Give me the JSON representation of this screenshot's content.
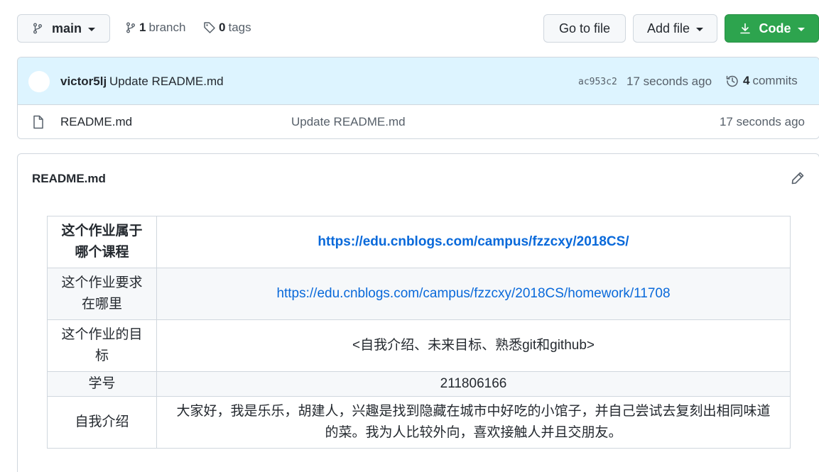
{
  "toolbar": {
    "branch_name": "main",
    "branch_count": "1",
    "branch_label": "branch",
    "tag_count": "0",
    "tag_label": "tags",
    "goto_label": "Go to file",
    "addfile_label": "Add file",
    "code_label": "Code"
  },
  "latest_commit": {
    "author": "victor5lj",
    "message": "Update README.md",
    "sha": "ac953c2",
    "time": "17 seconds ago",
    "commit_count": "4",
    "commit_label": "commits"
  },
  "files": [
    {
      "name": "README.md",
      "commit_message": "Update README.md",
      "time": "17 seconds ago"
    }
  ],
  "readme": {
    "title": "README.md",
    "rows": [
      {
        "key": "这个作业属于哪个课程",
        "value": "https://edu.cnblogs.com/campus/fzzcxy/2018CS/"
      },
      {
        "key": "这个作业要求在哪里",
        "value": "https://edu.cnblogs.com/campus/fzzcxy/2018CS/homework/11708"
      },
      {
        "key": "这个作业的目标",
        "value": "<自我介绍、未来目标、熟悉git和github>"
      },
      {
        "key": "学号",
        "value": "211806166"
      },
      {
        "key": "自我介绍",
        "value": "大家好，我是乐乐，胡建人，兴趣是找到隐藏在城市中好吃的小馆子，并自己尝试去复刻出相同味道的菜。我为人比较外向，喜欢接触人并且交朋友。"
      }
    ]
  },
  "colors": {
    "accent": "#0969da",
    "code_button": "#2da44e",
    "commit_bar": "#ddf4ff"
  }
}
